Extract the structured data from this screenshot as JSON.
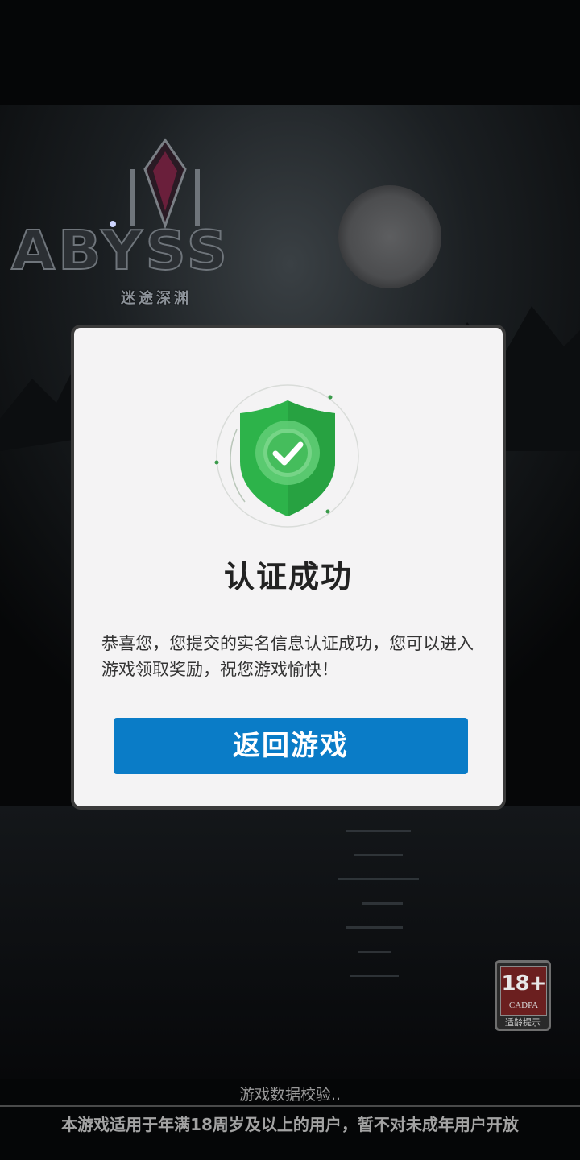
{
  "background": {
    "logo_text": "ABYSS",
    "logo_subtitle": "迷途深渊"
  },
  "dialog": {
    "icon": "shield-check-icon",
    "title": "认证成功",
    "message": "恭喜您，您提交的实名信息认证成功，您可以进入游戏领取奖励，祝您游戏愉快！",
    "button_label": "返回游戏",
    "button_color": "#0a7cc7",
    "shield_color": "#2db34a"
  },
  "age_rating": {
    "age": "18+",
    "org": "CADPA",
    "label": "适龄提示"
  },
  "footer": {
    "status": "游戏数据校验..",
    "notice": "本游戏适用于年满18周岁及以上的用户，暂不对未成年用户开放"
  }
}
